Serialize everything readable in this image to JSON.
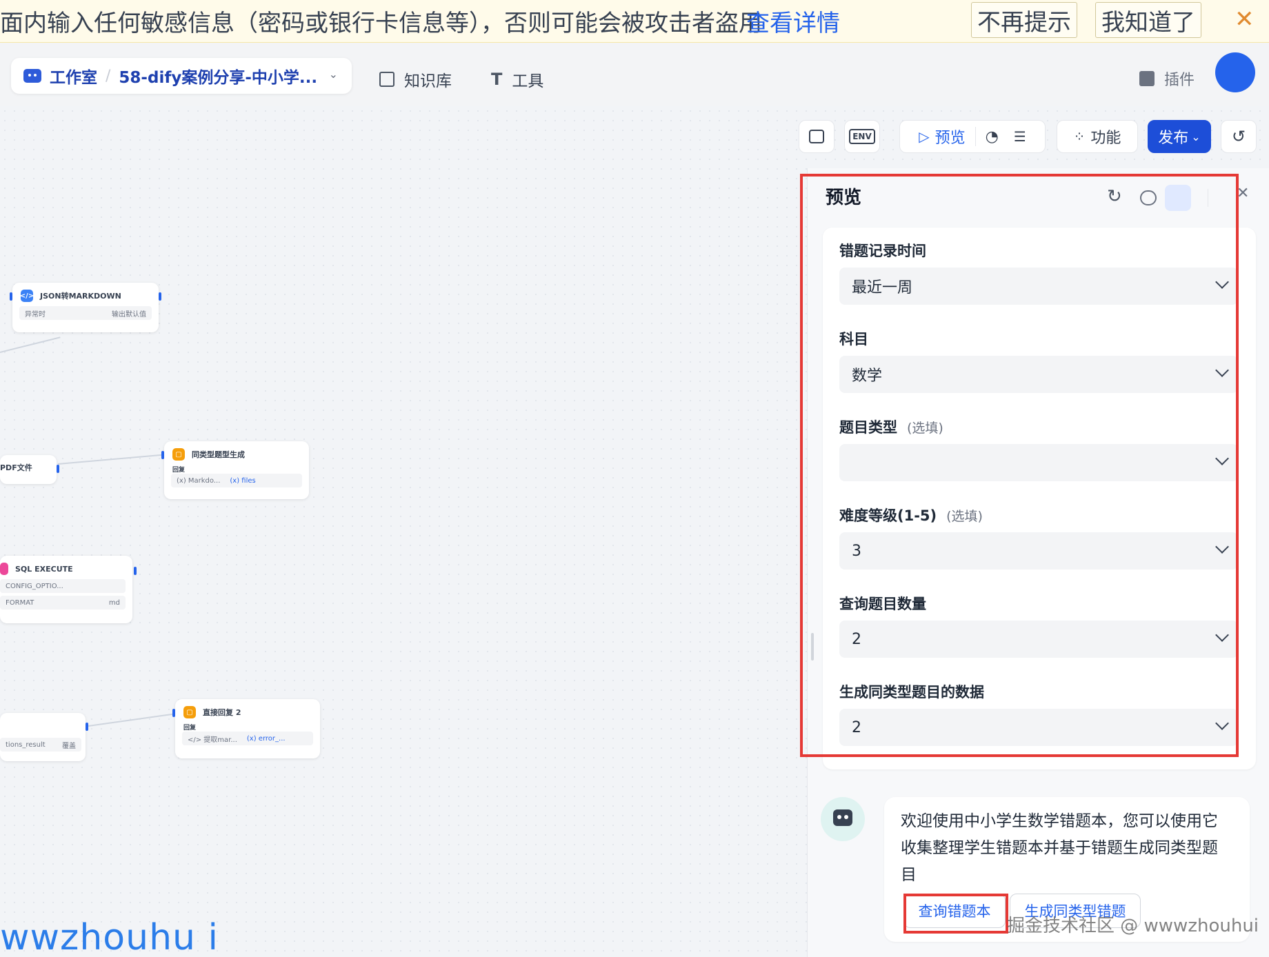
{
  "banner": {
    "text": "面内输入任何敏感信息（密码或银行卡信息等），否则可能会被攻击者盗用",
    "link": "查看详情",
    "dismiss_label": "不再提示",
    "ok_label": "我知道了",
    "close_icon": "close-icon"
  },
  "nav": {
    "workspace": "工作室",
    "app_name": "58-dify案例分享-中小学...",
    "knowledge": "知识库",
    "tools": "工具",
    "plugins": "插件"
  },
  "nodes": {
    "json_md": {
      "title": "JSON转MARKDOWN",
      "row_left": "异常时",
      "row_right": "输出默认值"
    },
    "pdf": {
      "title": "PDF文件"
    },
    "similar": {
      "title": "同类型题型生成",
      "label": "回复",
      "var1": "(x) Markdo...",
      "var2": "(x) files"
    },
    "sql": {
      "title": "SQL EXECUTE",
      "row1": "CONFIG_OPTIO...",
      "row2_left": "FORMAT",
      "row2_right": "md"
    },
    "direct": {
      "title": "直接回复 2",
      "label": "回复",
      "var1": "</> 提取mar...",
      "var2": "(x) error_..."
    },
    "result": {
      "row_left": "tions_result",
      "row_right": "覆盖"
    }
  },
  "toolbar": {
    "env_label": "ENV",
    "preview_label": "预览",
    "feature_label": "功能",
    "publish_label": "发布"
  },
  "panel": {
    "title": "预览",
    "fields": [
      {
        "label": "错题记录时间",
        "optional": "",
        "value": "最近一周"
      },
      {
        "label": "科目",
        "optional": "",
        "value": "数学"
      },
      {
        "label": "题目类型",
        "optional": "(选填)",
        "value": ""
      },
      {
        "label": "难度等级(1-5)",
        "optional": "(选填)",
        "value": "3"
      },
      {
        "label": "查询题目数量",
        "optional": "",
        "value": "2"
      },
      {
        "label": "生成同类型题目的数据",
        "optional": "",
        "value": "2"
      }
    ]
  },
  "chat": {
    "welcome": "欢迎使用中小学生数学错题本，您可以使用它收集整理学生错题本并基于错题生成同类型题目",
    "suggestions": [
      "查询错题本",
      "生成同类型错题"
    ]
  },
  "watermarks": {
    "left": "wwzhouhu i",
    "right": "掘金技术社区 @ wwwzhouhui"
  },
  "colors": {
    "accent": "#2563eb",
    "publish": "#1d4ed8",
    "highlight": "#e53935",
    "banner_bg": "#fffbea"
  }
}
